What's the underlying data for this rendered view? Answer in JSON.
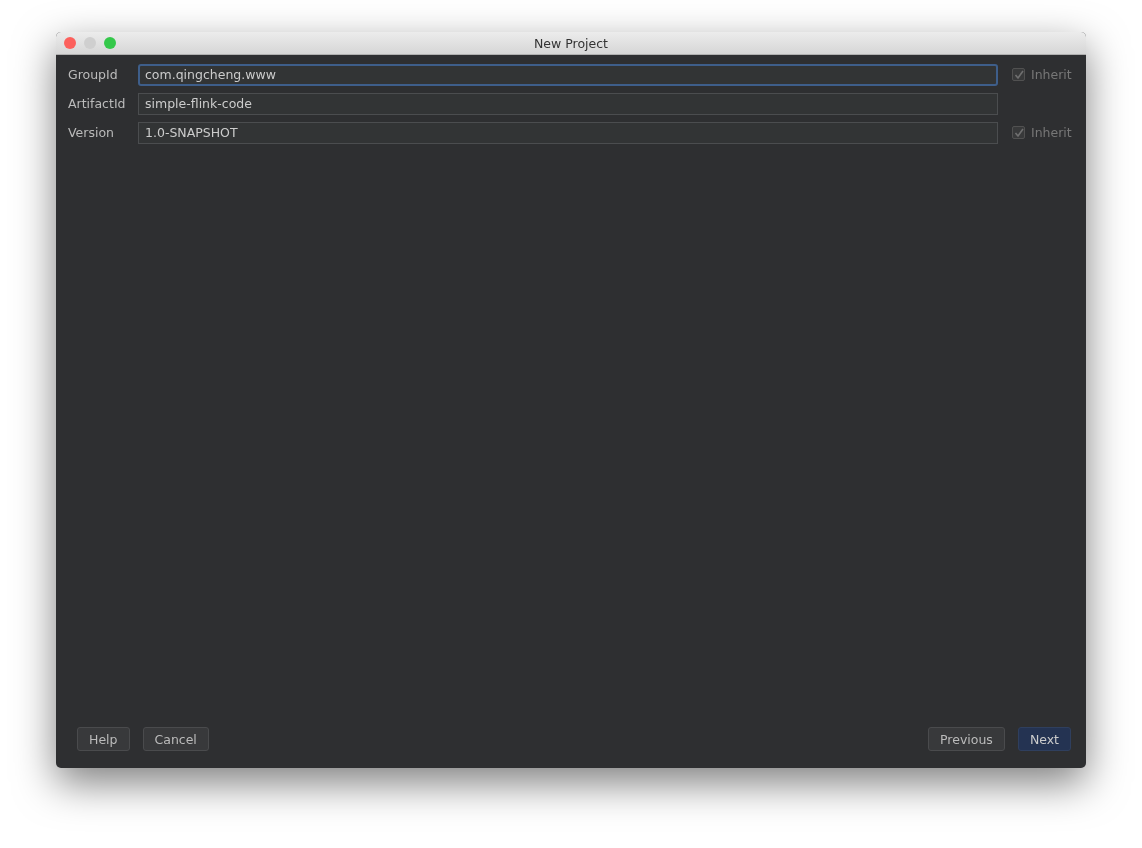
{
  "window": {
    "title": "New Project"
  },
  "fields": [
    {
      "label": "GroupId",
      "value": "com.qingcheng.www",
      "focused": true,
      "inherit": {
        "label": "Inherit",
        "checked": true,
        "disabled": true
      }
    },
    {
      "label": "ArtifactId",
      "value": "simple-flink-code",
      "focused": false
    },
    {
      "label": "Version",
      "value": "1.0-SNAPSHOT",
      "focused": false,
      "inherit": {
        "label": "Inherit",
        "checked": true,
        "disabled": true
      }
    }
  ],
  "buttons_left": [
    {
      "label": "Help",
      "kind": "normal"
    },
    {
      "label": "Cancel",
      "kind": "normal"
    }
  ],
  "buttons_right": [
    {
      "label": "Previous",
      "kind": "normal"
    },
    {
      "label": "Next",
      "kind": "default"
    }
  ]
}
